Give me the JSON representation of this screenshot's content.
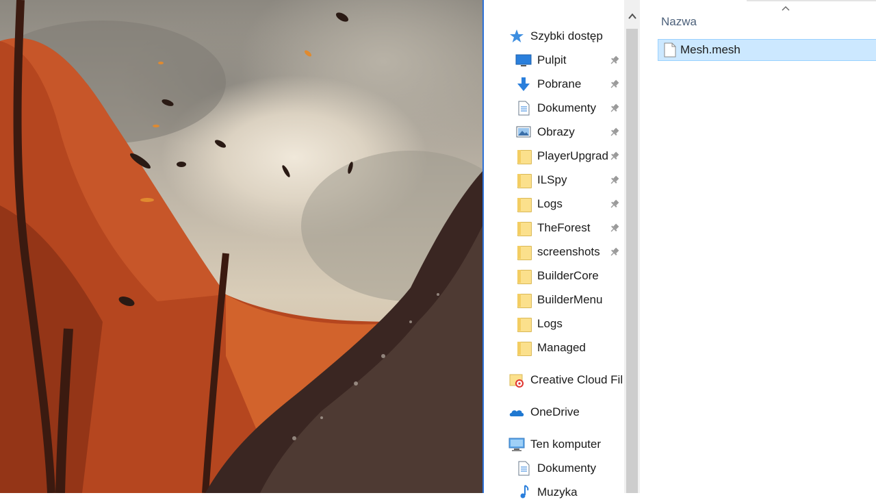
{
  "nav": {
    "quick_access": "Szybki dostęp",
    "items": [
      {
        "label": "Pulpit",
        "icon": "desktop-icon",
        "pinned": true
      },
      {
        "label": "Pobrane",
        "icon": "download-arrow-icon",
        "pinned": true
      },
      {
        "label": "Dokumenty",
        "icon": "document-icon",
        "pinned": true
      },
      {
        "label": "Obrazy",
        "icon": "pictures-icon",
        "pinned": true
      },
      {
        "label": "PlayerUpgrad",
        "icon": "folder-icon",
        "pinned": true
      },
      {
        "label": "ILSpy",
        "icon": "folder-icon",
        "pinned": true
      },
      {
        "label": "Logs",
        "icon": "folder-icon",
        "pinned": true
      },
      {
        "label": "TheForest",
        "icon": "folder-icon",
        "pinned": true
      },
      {
        "label": "screenshots",
        "icon": "folder-icon",
        "pinned": true
      },
      {
        "label": "BuilderCore",
        "icon": "folder-icon",
        "pinned": false
      },
      {
        "label": "BuilderMenu",
        "icon": "folder-icon",
        "pinned": false
      },
      {
        "label": "Logs",
        "icon": "folder-icon",
        "pinned": false
      },
      {
        "label": "Managed",
        "icon": "folder-icon",
        "pinned": false
      }
    ],
    "creative_cloud": "Creative Cloud Fil",
    "onedrive": "OneDrive",
    "this_pc": "Ten komputer",
    "pc_items": [
      {
        "label": "Dokumenty",
        "icon": "document-icon"
      },
      {
        "label": "Muzyka",
        "icon": "music-icon"
      }
    ]
  },
  "content": {
    "column_header": "Nazwa",
    "files": [
      {
        "name": "Mesh.mesh",
        "icon": "file-icon",
        "selected": true
      }
    ]
  },
  "colors": {
    "selection_bg": "#cce8ff",
    "selection_border": "#99d1ff",
    "window_accent": "#2b6fd6",
    "header_text": "#4c607a"
  }
}
